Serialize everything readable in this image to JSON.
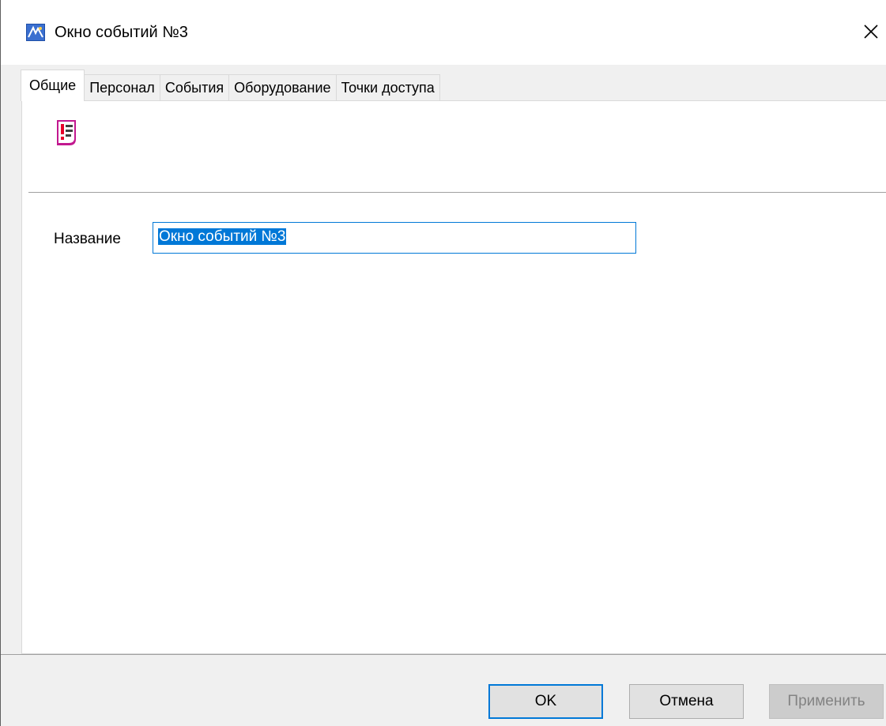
{
  "window": {
    "title": "Окно событий №3",
    "app_icon": "app-logo-icon",
    "close_icon": "close-icon"
  },
  "tabs": [
    {
      "label": "Общие",
      "active": true
    },
    {
      "label": "Персонал",
      "active": false
    },
    {
      "label": "События",
      "active": false
    },
    {
      "label": "Оборудование",
      "active": false
    },
    {
      "label": "Точки доступа",
      "active": false
    }
  ],
  "general": {
    "page_icon": "event-list-icon",
    "name_label": "Название",
    "name_value": "Окно событий №3"
  },
  "buttons": {
    "ok": "OK",
    "cancel": "Отмена",
    "apply": "Применить",
    "apply_enabled": false
  },
  "colors": {
    "accent": "#0078d7",
    "icon_red": "#e8002a",
    "icon_magenta": "#c2188f"
  }
}
